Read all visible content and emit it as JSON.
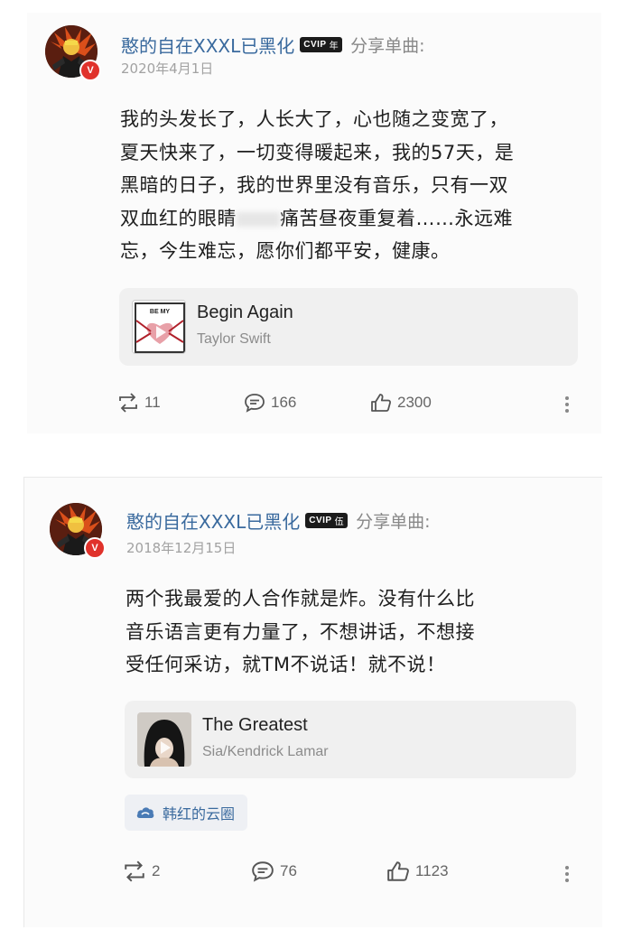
{
  "posts": [
    {
      "username": "憨的自在XXXL已黑化",
      "vip_label": "CVIP",
      "vip_level": "年",
      "share_text": "分享单曲:",
      "date": "2020年4月1日",
      "content_lines": [
        "我的头发长了，人长大了，心也随之变宽了，",
        "夏天快来了，一切变得暖起来，我的57天，是",
        "黑暗的日子，我的世界里没有音乐，只有一双",
        "双血红的眼睛",
        "痛苦昼夜重复着……永远难",
        "忘，今生难忘，愿你们都平安，健康。"
      ],
      "music": {
        "title": "Begin Again",
        "artist": "Taylor Swift",
        "cover_text": "BE MY"
      },
      "reposts": "11",
      "comments": "166",
      "likes": "2300"
    },
    {
      "username": "憨的自在XXXL已黑化",
      "vip_label": "CVIP",
      "vip_level": "伍",
      "share_text": "分享单曲:",
      "date": "2018年12月15日",
      "content_lines": [
        "两个我最爱的人合作就是炸。没有什么比",
        "音乐语言更有力量了，不想讲话，不想接",
        "受任何采访，就TM不说话！就不说！"
      ],
      "music": {
        "title": "The Greatest",
        "artist": "Sia/Kendrick Lamar"
      },
      "circle_tag": "韩红的云圈",
      "reposts": "2",
      "comments": "76",
      "likes": "1123"
    }
  ],
  "colors": {
    "username": "#3a6a9e",
    "badge_red": "#e0322b",
    "vip_bg": "#1b1b1b",
    "card_bg": "#f0f0f0"
  },
  "icons": {
    "repost": "repost-icon",
    "comment": "comment-icon",
    "like": "thumbs-up-icon",
    "more": "more-vertical-icon",
    "verified": "verified-v-icon",
    "circle": "cloud-circle-icon"
  }
}
